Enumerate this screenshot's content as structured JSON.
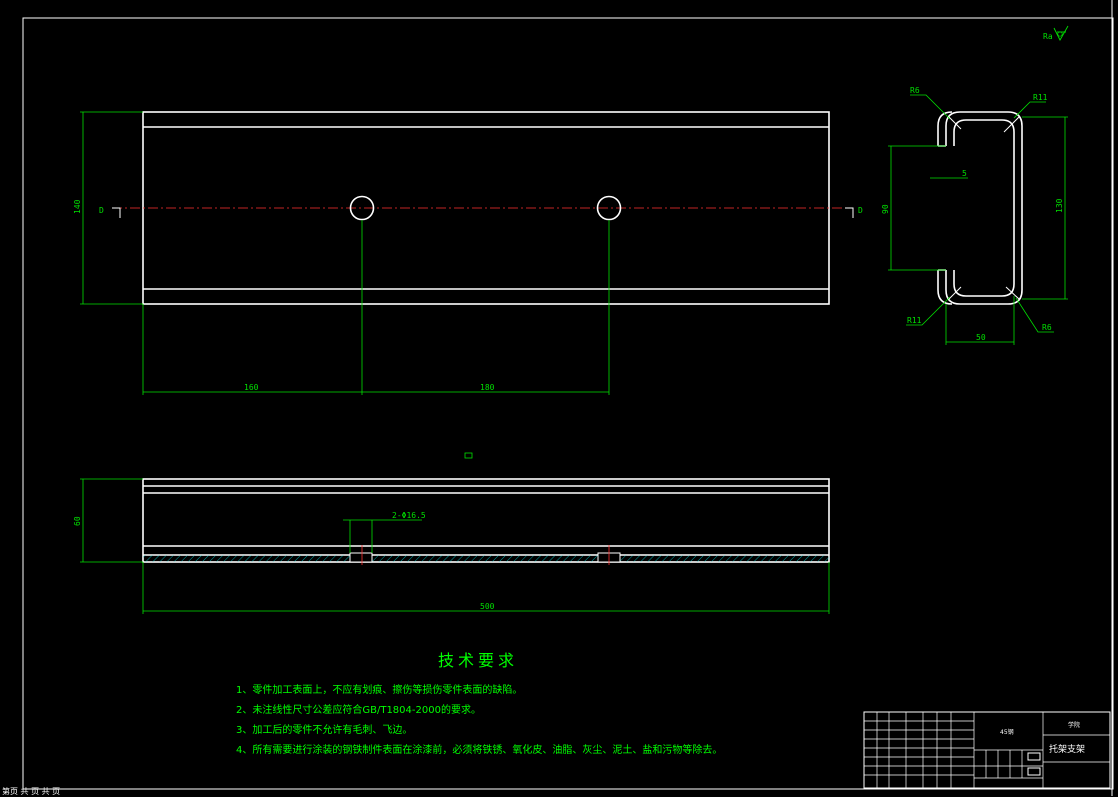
{
  "drawing": {
    "roughness_mark": "Ra",
    "front_view": {
      "dim_height": "140",
      "dim_left": "160",
      "dim_right": "180",
      "section_mark_left": "D",
      "section_mark_right": "D"
    },
    "side_view": {
      "radius_top_left": "R6",
      "radius_top_right": "R11",
      "radius_bottom_left": "R11",
      "radius_bottom_right": "R6",
      "dim_thickness": "5",
      "dim_opening": "90",
      "dim_height": "130",
      "dim_width": "50"
    },
    "top_view": {
      "dim_height": "60",
      "dim_hole": "2-Φ16.5",
      "dim_length": "500"
    },
    "notes": {
      "title": "技术要求",
      "items": [
        "1、零件加工表面上，不应有划痕、擦伤等损伤零件表面的缺陷。",
        "2、未注线性尺寸公差应符合GB/T1804-2000的要求。",
        "3、加工后的零件不允许有毛刺、飞边。",
        "4、所有需要进行涂装的钢铁制件表面在涂漆前，必须将铁锈、氧化皮、油脂、灰尘、泥土、盐和污物等除去。"
      ]
    },
    "title_block": {
      "material": "45钢",
      "name": "托架支架",
      "school": "学院"
    },
    "status_line": "第页 共 页 共 页"
  }
}
